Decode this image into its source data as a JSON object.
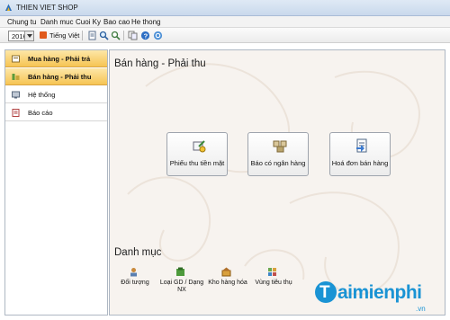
{
  "window": {
    "title": "THIEN VIET SHOP"
  },
  "menu": [
    "Chung tu",
    "Danh muc",
    "Cuoi Ky",
    "Bao cao",
    "He thong"
  ],
  "toolbar": {
    "year": "2016",
    "language": "Tiếng Việt",
    "icons": [
      "document-icon",
      "search-icon",
      "zoom-icon",
      "copy-icon",
      "print-icon",
      "help-icon",
      "refresh-icon"
    ]
  },
  "sidebar": {
    "items": [
      {
        "label": "Mua hàng - Phải trả",
        "icon": "cart-icon"
      },
      {
        "label": "Bán hàng - Phải thu",
        "icon": "sales-icon",
        "active": true
      },
      {
        "label": "Hệ thống",
        "icon": "system-icon"
      },
      {
        "label": "Báo cáo",
        "icon": "report-icon"
      }
    ]
  },
  "main": {
    "title": "Bán hàng - Phải thu",
    "actions": [
      {
        "label": "Phiếu thu tiền mặt",
        "icon": "cash-receipt-icon"
      },
      {
        "label": "Báo có ngân hàng",
        "icon": "bank-credit-icon"
      },
      {
        "label": "Hoá đơn bán hàng",
        "icon": "invoice-icon"
      }
    ],
    "categories_title": "Danh mục",
    "categories": [
      {
        "label": "Đối tượng",
        "icon": "contacts-icon"
      },
      {
        "label": "Loại GD / Dạng NX",
        "icon": "transaction-type-icon"
      },
      {
        "label": "Kho hàng hóa",
        "icon": "warehouse-icon"
      },
      {
        "label": "Vùng tiêu thụ",
        "icon": "region-icon"
      }
    ]
  },
  "watermark": {
    "brand": "aimienphi",
    "domain": ".vn"
  },
  "colors": {
    "highlight": "#f6c453",
    "watermark": "#1a93d4"
  }
}
